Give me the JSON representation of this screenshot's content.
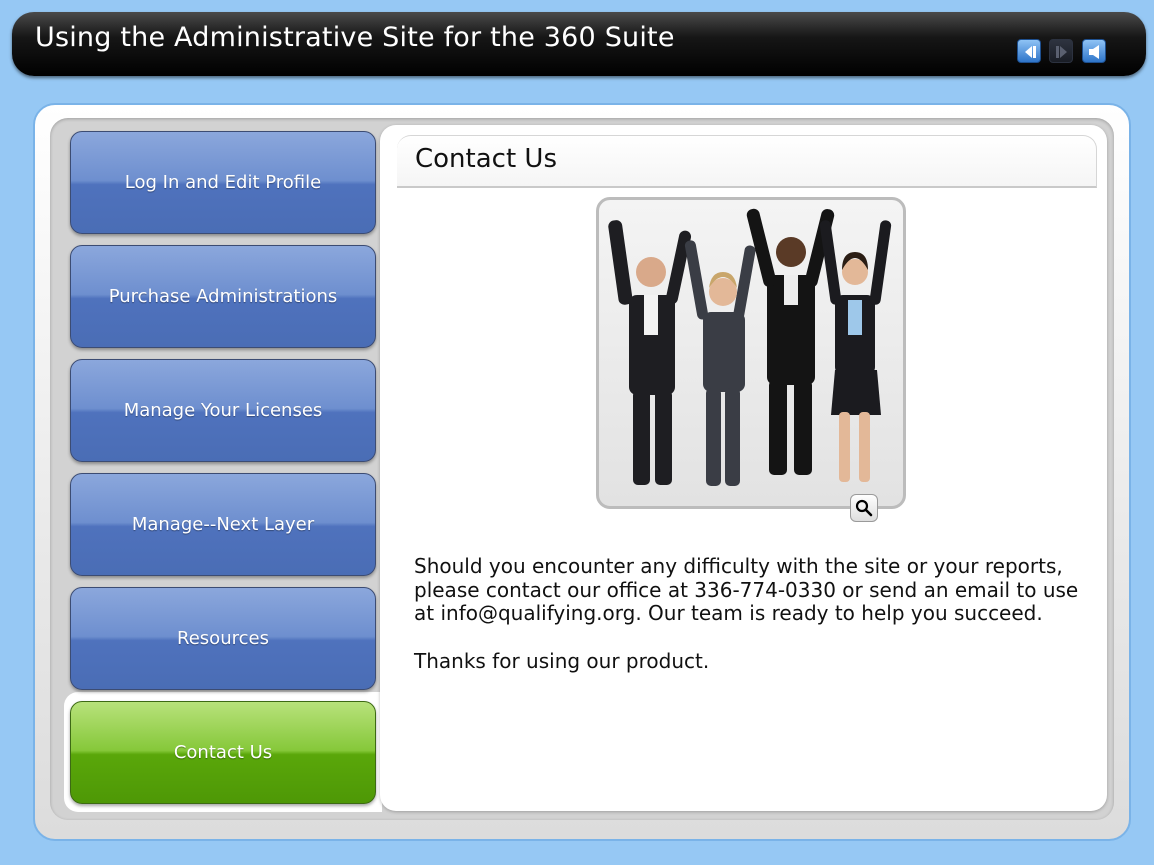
{
  "window": {
    "title": "Using the Administrative Site for the 360 Suite"
  },
  "controls": {
    "prev_icon": "previous-icon",
    "next_icon": "next-icon",
    "audio_icon": "speaker-icon"
  },
  "nav": {
    "items": [
      {
        "label": "Log In and Edit Profile",
        "active": false
      },
      {
        "label": "Purchase Administrations",
        "active": false
      },
      {
        "label": "Manage Your Licenses",
        "active": false
      },
      {
        "label": "Manage--Next Layer",
        "active": false
      },
      {
        "label": "Resources",
        "active": false
      },
      {
        "label": "Contact Us",
        "active": true
      }
    ]
  },
  "content": {
    "heading": "Contact Us",
    "paragraph1": "Should you encounter any difficulty with the site or your reports, please contact our office at 336-774-0330 or send an email to use at info@qualifying.org. Our team is ready to help you succeed.",
    "paragraph2": "Thanks for using our product.",
    "zoom_icon": "magnifier-icon"
  },
  "colors": {
    "background": "#96c8f4",
    "nav_blue": "#4f72bd",
    "nav_active_green": "#5aa70a"
  }
}
